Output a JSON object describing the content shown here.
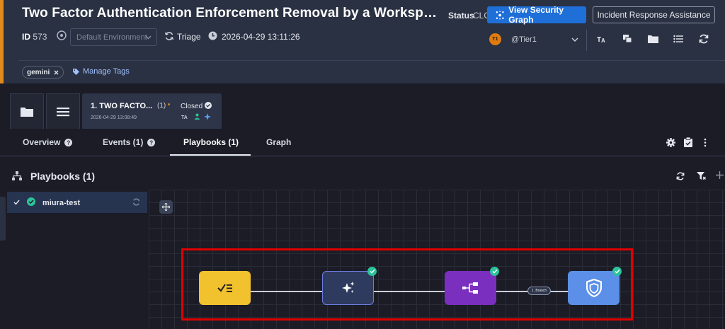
{
  "case": {
    "title": "Two Factor Authentication Enforcement Removal by a Workspace Ad...",
    "status_label": "Status",
    "status_value": "CLO",
    "view_graph_label": "View Security Graph",
    "incident_response_label": "Incident Response Assistance",
    "id_label": "ID",
    "id_value": "573",
    "environment_placeholder": "Default Environment",
    "stage": "Triage",
    "datetime": "2026-04-29 13:11:26",
    "assignee_initials": "T1",
    "assignee": "@Tier1",
    "accent_color": "#e08a1e"
  },
  "tags": {
    "chip": "gemini",
    "manage_label": "Manage Tags"
  },
  "alert_card": {
    "title": "1. TWO FACTO...",
    "count": "(1)",
    "status": "Closed",
    "date": "2026-04-29 13:08:49"
  },
  "nav": {
    "tabs": [
      "Overview",
      "Events (1)",
      "Playbooks (1)",
      "Graph"
    ],
    "active": "Playbooks (1)"
  },
  "playbooks": {
    "title": "Playbooks (1)",
    "items": [
      {
        "name": "miura-test",
        "status": "completed"
      }
    ]
  },
  "flow": {
    "nodes": [
      {
        "name": "task",
        "color": "#f2c12e",
        "completed": false
      },
      {
        "name": "gemini-action",
        "color": "#2f3b5e",
        "completed": true
      },
      {
        "name": "condition",
        "color": "#7b2fbf",
        "completed": true
      },
      {
        "name": "shield-action",
        "color": "#5b8fe8",
        "completed": true
      }
    ],
    "branch_label": "1. Branch"
  },
  "colors": {
    "primary_button": "#1f6fd8",
    "success": "#2bc39a",
    "highlight": "#e00000"
  }
}
